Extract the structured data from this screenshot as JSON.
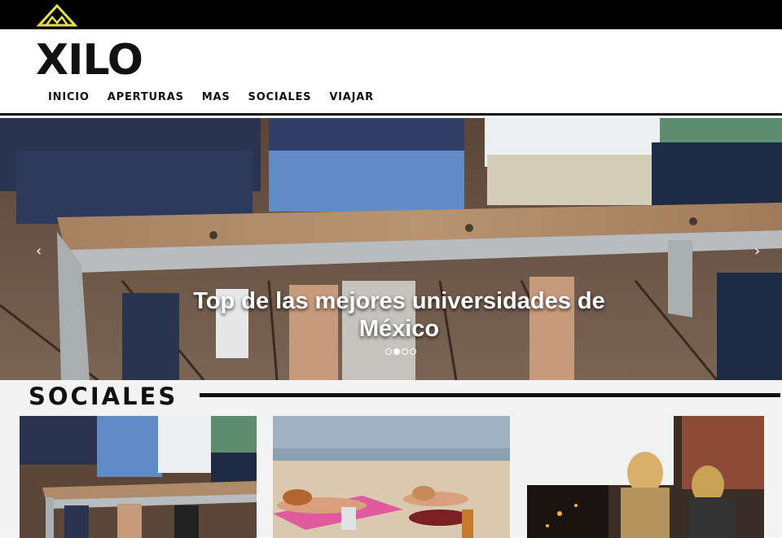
{
  "brand": {
    "logo_text": "XILO",
    "mini_logo_icon": "mountain-triangle-icon",
    "accent_color": "#e8e04a"
  },
  "nav": {
    "items": [
      {
        "label": "INICIO"
      },
      {
        "label": "APERTURAS"
      },
      {
        "label": "MAS"
      },
      {
        "label": "SOCIALES"
      },
      {
        "label": "VIAJAR"
      }
    ]
  },
  "hero": {
    "caption": "Top de las mejores universidades de México",
    "prev_icon": "chevron-left-icon",
    "next_icon": "chevron-right-icon",
    "prev_glyph": "‹",
    "next_glyph": "›",
    "slide_count": 4,
    "active_slide": 2
  },
  "section": {
    "title": "SOCIALES"
  },
  "cards": [
    {
      "image": "people-on-bench-photo"
    },
    {
      "image": "beach-sunbathing-photo"
    },
    {
      "image": "couple-by-fireplace-photo"
    }
  ]
}
